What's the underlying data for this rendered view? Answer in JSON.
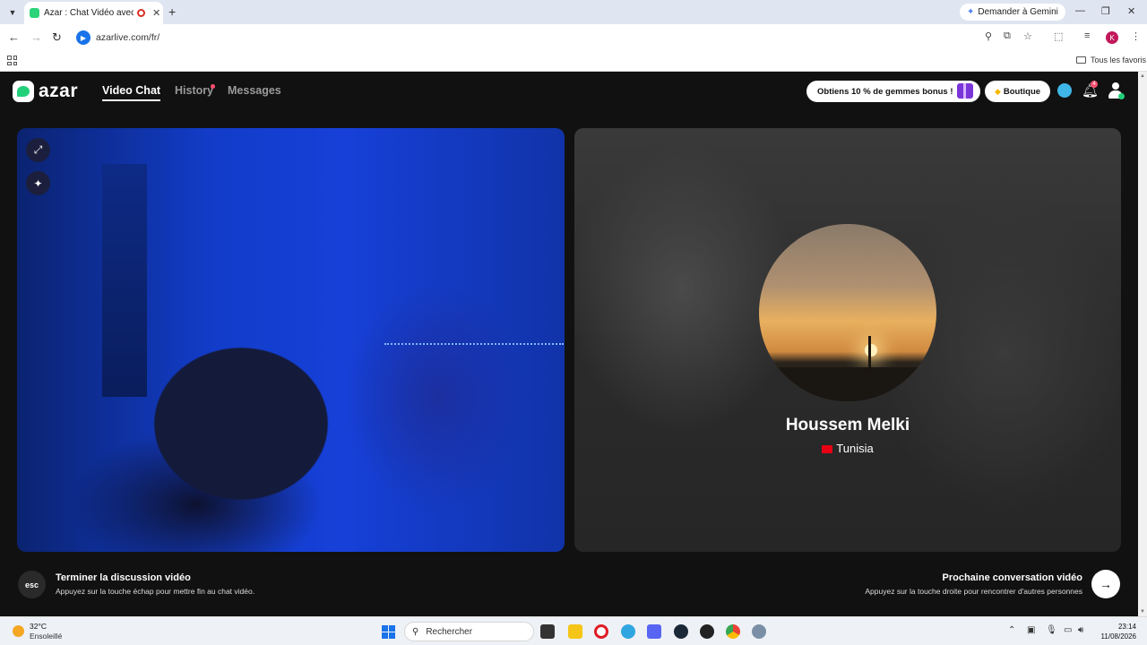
{
  "browser": {
    "tab": {
      "title": "Azar : Chat Vidéo avec de n"
    },
    "gemini_button": "Demander à Gemini",
    "url": "azarlive.com/fr/",
    "profile_initial": "K",
    "bookmarks": {
      "all_favorites": "Tous les favoris"
    }
  },
  "app": {
    "logo": "azar",
    "nav": [
      {
        "label": "Video Chat"
      },
      {
        "label": "History"
      },
      {
        "label": "Messages"
      }
    ],
    "promo": "Obtiens 10 % de gemmes bonus !",
    "shop": "Boutique",
    "notification_count": "4",
    "peer": {
      "name": "Houssem Melki",
      "country": "Tunisia"
    },
    "end_call": {
      "key": "esc",
      "title": "Terminer la discussion vidéo",
      "subtitle": "Appuyez sur la touche échap pour mettre fin au chat vidéo."
    },
    "next_call": {
      "title": "Prochaine conversation vidéo",
      "subtitle": "Appuyez sur la touche droite pour rencontrer d'autres personnes"
    },
    "colors": {
      "accent_green": "#22d07a",
      "badge_red": "#ff4d6d",
      "background": "#111111"
    }
  },
  "taskbar": {
    "weather": {
      "temp": "32°C",
      "status": "Ensoleillé"
    },
    "search_placeholder": "Rechercher",
    "time": "23:14",
    "date": "11/08/2026"
  }
}
